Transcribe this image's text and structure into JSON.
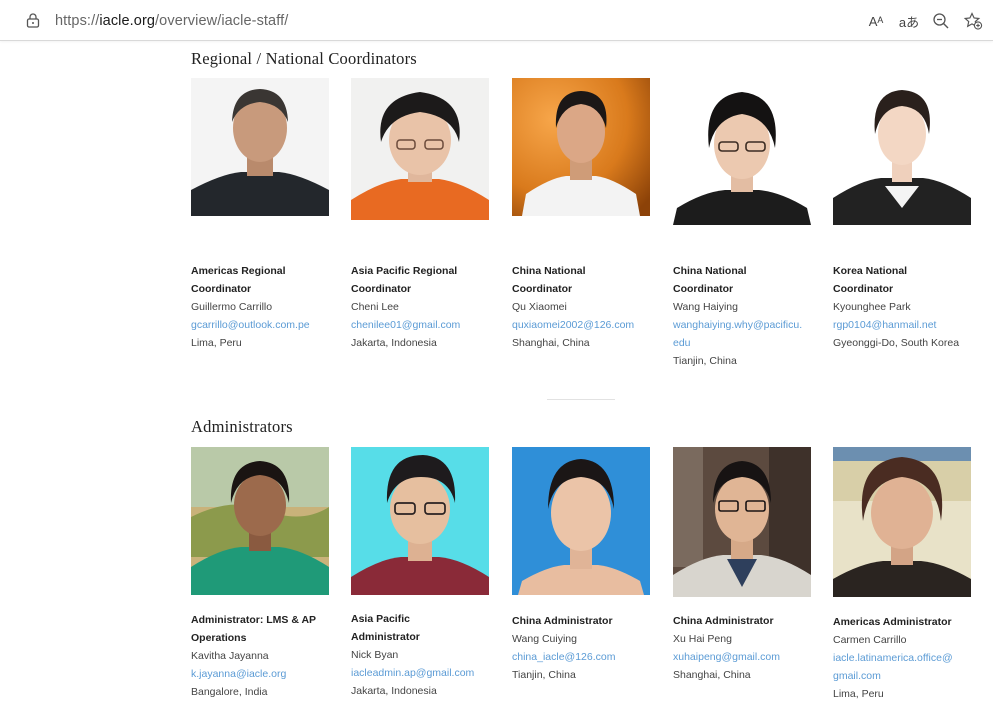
{
  "browser": {
    "url_prefix": "https://",
    "url_host": "iacle.org",
    "url_path": "/overview/iacle-staff/",
    "read_aloud_glyph": "Aᴬ",
    "translate_glyph": "aあ"
  },
  "sections": [
    {
      "title": "Regional / National Coordinators",
      "people": [
        {
          "role_line1": "Americas Regional",
          "role_line2": "Coordinator",
          "name": "Guillermo Carrillo",
          "email": "gcarrillo@outlook.com.pe",
          "location": "Lima, Peru"
        },
        {
          "role_line1": "Asia Pacific Regional",
          "role_line2": "Coordinator",
          "name": "Cheni Lee",
          "email": "chenilee01@gmail.com",
          "location": "Jakarta, Indonesia"
        },
        {
          "role_line1": "China National",
          "role_line2": "Coordinator",
          "name": "Qu Xiaomei",
          "email": "quxiaomei2002@126.com",
          "location": "Shanghai, China"
        },
        {
          "role_line1": "China National",
          "role_line2": "Coordinator",
          "name": "Wang Haiying",
          "email_line1": "wanghaiying.why@pacificu.",
          "email_line2": "edu",
          "location": "Tianjin, China"
        },
        {
          "role_line1": "Korea National",
          "role_line2": "Coordinator",
          "name": "Kyounghee Park",
          "email": "rgp0104@hanmail.net",
          "location": "Gyeonggi-Do, South Korea"
        }
      ]
    },
    {
      "title": "Administrators",
      "people": [
        {
          "role_line1": "Administrator: LMS & AP",
          "role_line2": "Operations",
          "name": "Kavitha Jayanna",
          "email": "k.jayanna@iacle.org",
          "location": "Bangalore, India"
        },
        {
          "role_line1": "Asia Pacific",
          "role_line2": "Administrator",
          "name": "Nick Byan",
          "email": "iacleadmin.ap@gmail.com",
          "location": "Jakarta, Indonesia"
        },
        {
          "role_line1": "China Administrator",
          "name": "Wang Cuiying",
          "email": "china_iacle@126.com",
          "location": "Tianjin, China"
        },
        {
          "role_line1": "China Administrator",
          "name": "Xu Hai Peng",
          "email": "xuhaipeng@gmail.com",
          "location": "Shanghai, China"
        },
        {
          "role_line1": "Americas Administrator",
          "name": "Carmen Carrillo",
          "email_line1": "iacle.latinamerica.office@",
          "email_line2": "gmail.com",
          "location": "Lima, Peru"
        }
      ]
    }
  ],
  "colors": {
    "link": "#5b9bd5",
    "heading": "#222222"
  }
}
